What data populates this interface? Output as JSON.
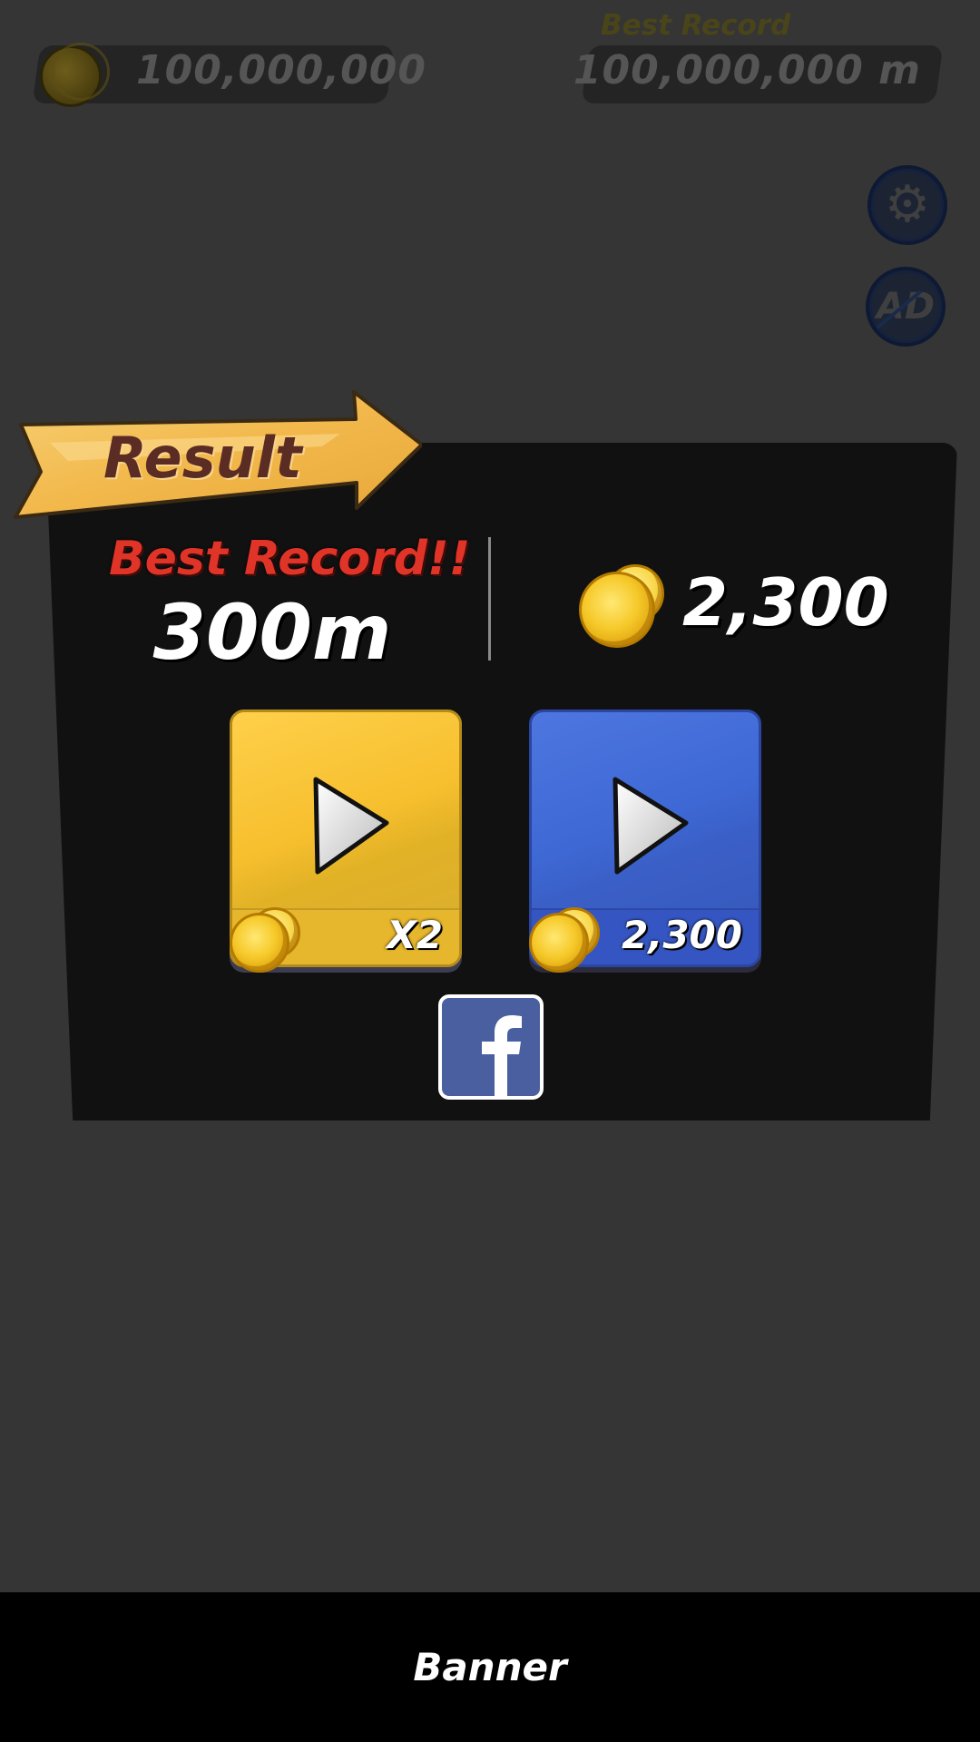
{
  "hud": {
    "coin_total": "100,000,000",
    "best_record_caption": "Best Record",
    "best_record_value": "100,000,000 m"
  },
  "icons": {
    "settings": "gear-icon",
    "ad": "ad-icon",
    "coin": "coin-icon",
    "play": "play-icon",
    "facebook": "facebook-icon"
  },
  "result": {
    "title": "Result",
    "best_label": "Best Record!!",
    "distance": "300m",
    "coins_earned": "2,300"
  },
  "buttons": {
    "double_label": "X2",
    "play_cost_label": "2,300"
  },
  "banner": {
    "label": "Banner"
  },
  "colors": {
    "background": "#353535",
    "panel": "#111111",
    "ribbon": "#f2b84b",
    "best_record_red": "#e03428",
    "yellow_button": "#f6bf2e",
    "blue_button": "#3e68d4",
    "facebook": "#4a5fa0"
  }
}
